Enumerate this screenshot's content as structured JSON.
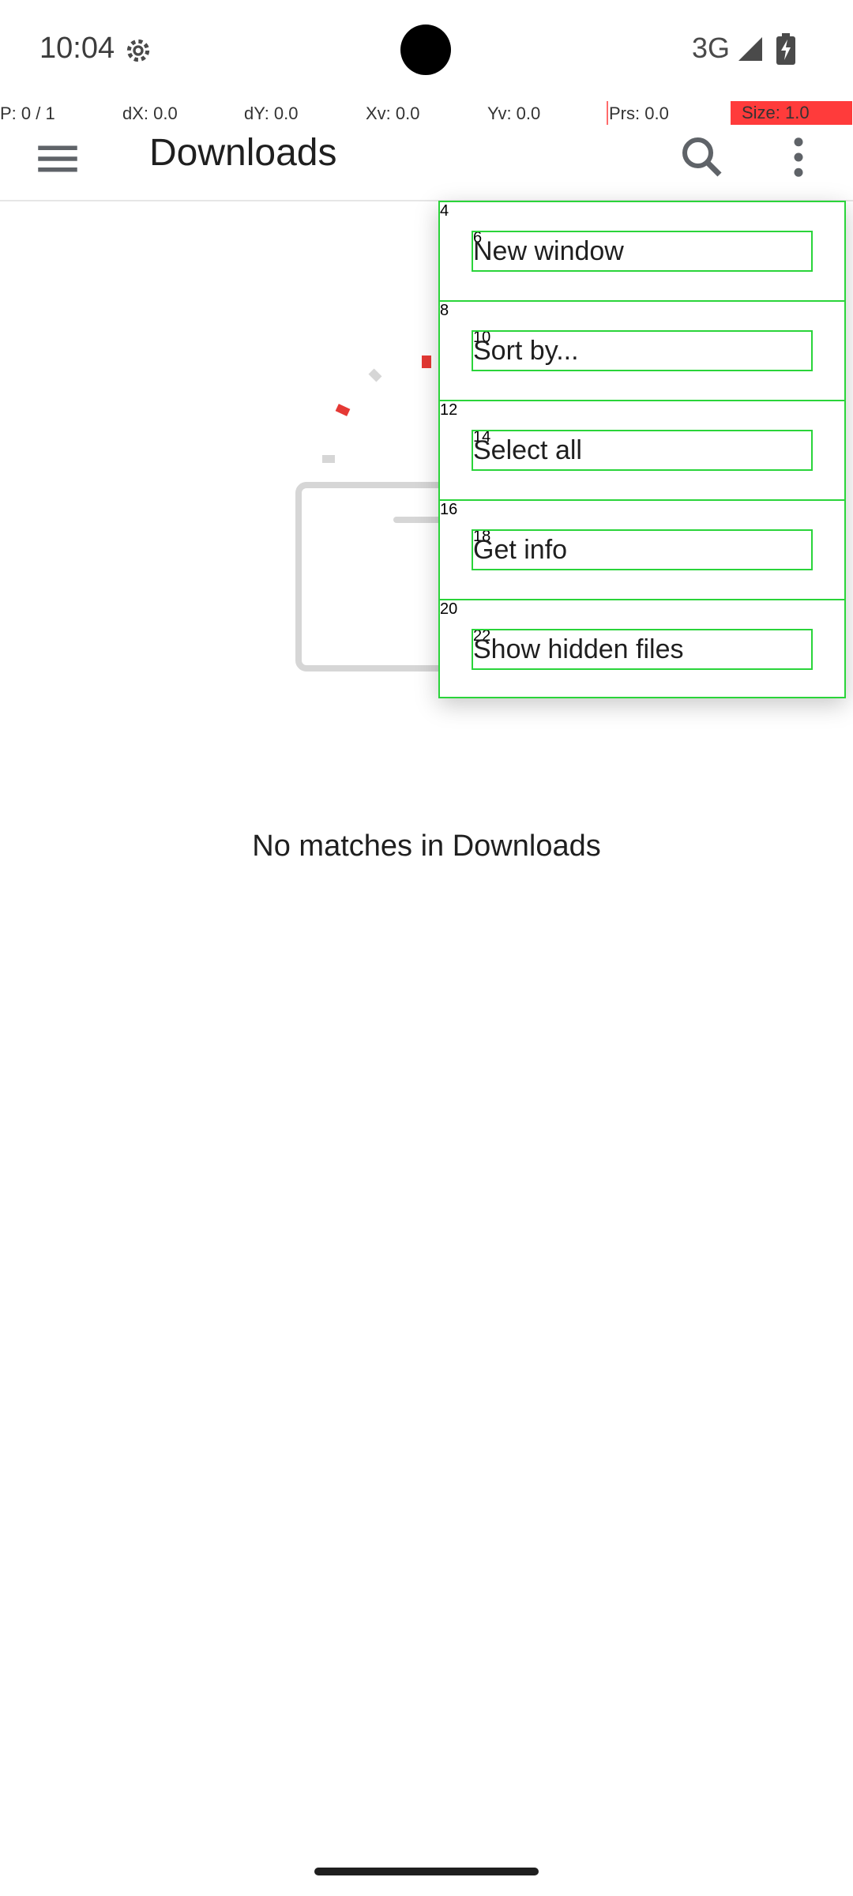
{
  "status_bar": {
    "time": "10:04",
    "network": "3G"
  },
  "pointer_overlay": {
    "p": "P: 0 / 1",
    "dx": "dX: 0.0",
    "dy": "dY: 0.0",
    "xv": "Xv: 0.0",
    "yv": "Yv: 0.0",
    "prs": "Prs: 0.0",
    "size": "Size: 1.0"
  },
  "toolbar": {
    "title": "Downloads"
  },
  "empty_state": {
    "message": "No matches in Downloads"
  },
  "overflow_menu": {
    "items": [
      {
        "index": "4",
        "label_index": "6",
        "label": "New window"
      },
      {
        "index": "8",
        "label_index": "10",
        "label": "Sort by..."
      },
      {
        "index": "12",
        "label_index": "14",
        "label": "Select all"
      },
      {
        "index": "16",
        "label_index": "18",
        "label": "Get info"
      },
      {
        "index": "20",
        "label_index": "22",
        "label": "Show hidden files"
      }
    ]
  },
  "colors": {
    "accent_overlay": "#2ad43a",
    "size_highlight": "#ff3b3b",
    "illustration_red": "#e53935",
    "illustration_gray": "#d6d6d6"
  },
  "icons": [
    "gear-icon",
    "signal-icon",
    "battery-icon",
    "hamburger-icon",
    "search-icon",
    "more-vert-icon"
  ]
}
